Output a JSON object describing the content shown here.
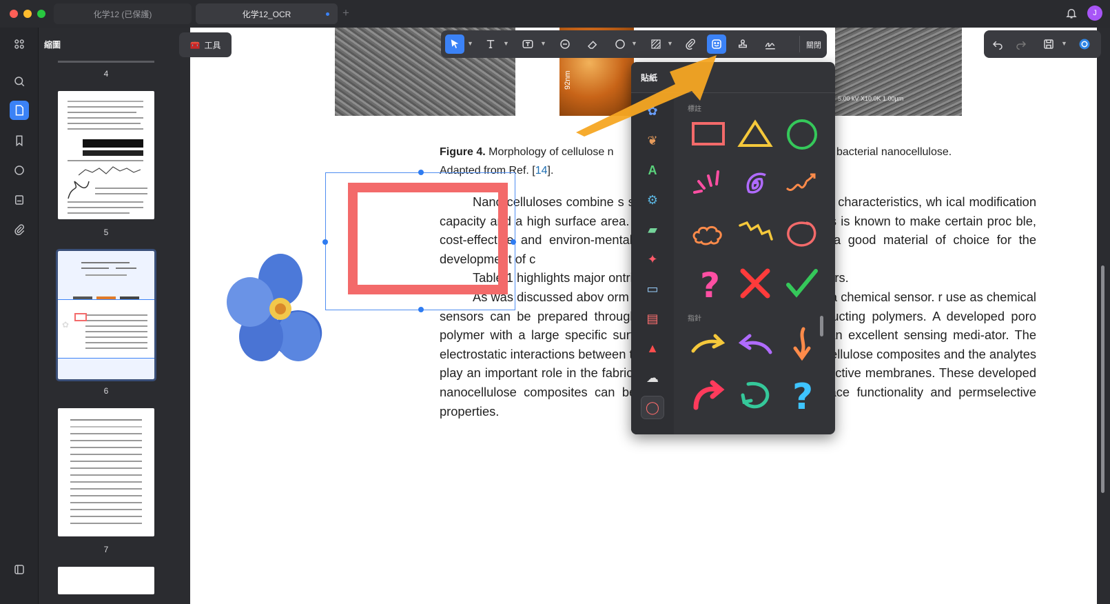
{
  "window": {
    "tabs": [
      {
        "label": "化学12 (已保護)",
        "active": false
      },
      {
        "label": "化学12_OCR",
        "active": true
      }
    ],
    "avatar_initial": "J"
  },
  "thumbnail_panel": {
    "title": "縮圖",
    "pages": [
      {
        "number": "4"
      },
      {
        "number": "5"
      },
      {
        "number": "6",
        "selected": true
      },
      {
        "number": "7"
      }
    ]
  },
  "tools_button": {
    "label": "工具"
  },
  "toolbar": {
    "close_label": "關閉",
    "active_tool": "sticker"
  },
  "document": {
    "figure_caption": {
      "label": "Figure 4.",
      "text_left": "Morphology of cellulose n",
      "text_right": "bacterial nanocellulose.",
      "line2_prefix": "Adapted from Ref. [",
      "ref": "14",
      "line2_suffix": "]."
    },
    "image_labels": {
      "scale": "92nm",
      "sem_text": "5.00 kV  X10.0K  1.00µm"
    },
    "paragraphs": [
      "Nano celluloses combine                              s such as hydrophilicity and crystalline characteristics, wh                        ical modification capacity and a high surface area. The us                           ther materials in composites is known to make certain proc                        ble, cost-effective and environ-mentally friendly. Nanocellulo                      making it a good material of choice for the development of c",
      "Table 1 highlights major                              ontribute to their use as chemi-cal sensors.",
      "As was discussed abov                              orm has limitations in its appli-cation as a chemical sensor.                        r use as chemical sensors can be prepared through surface                        ellulose with other conducting polymers. A developed poro                        polymer with a large specific surface area that possesses e                      o be an excellent sensing medi-ator. The electrostatic interactions between the different charges found in nanocellulose composites and the analytes play an important role in the fabrication of ion exchange and permselective membranes. These developed nanocellulose composites can be modified by changing their surface functionality and permselective properties."
    ]
  },
  "sticker_popup": {
    "title": "貼紙",
    "section_annotation": "標註",
    "section_pointer": "指針",
    "categories": [
      "flower",
      "bear",
      "letter-a",
      "robot",
      "car",
      "star",
      "sneaker",
      "calendar",
      "santa",
      "cloud",
      "circle-outline"
    ],
    "annotation_stickers": [
      "rectangle",
      "triangle",
      "circle",
      "emphasis-lines",
      "spiral",
      "squiggle-arrow",
      "cloud-shape",
      "zigzag-arrow",
      "loop-circle",
      "question-mark",
      "cross-mark",
      "check-mark"
    ],
    "pointer_stickers": [
      "arrow-right",
      "arrow-back-left",
      "arrow-down",
      "curved-arrow-right",
      "u-turn-arrow",
      "question-mark-blue"
    ]
  },
  "colors": {
    "accent": "#3b82f6",
    "highlight_arrow": "#f6a623",
    "sticker_red": "#f36a6a",
    "selection": "#4d8cf0"
  }
}
